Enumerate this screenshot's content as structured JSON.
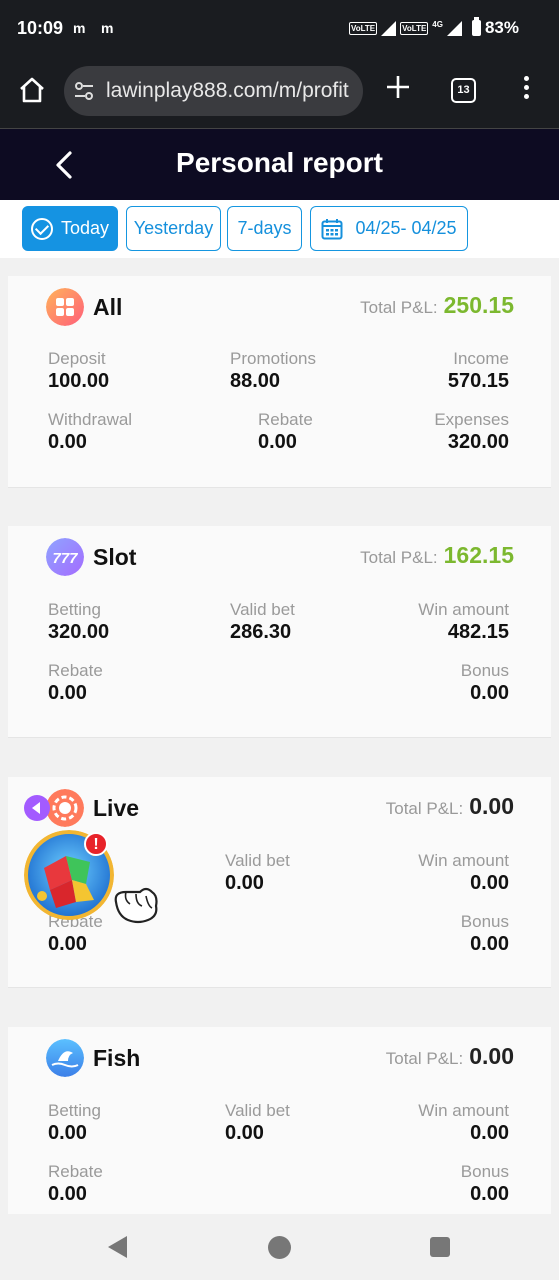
{
  "status_bar": {
    "time": "10:09",
    "notifications": [
      "m",
      "m"
    ],
    "network_labels": [
      "VoLTE",
      "VoLTE"
    ],
    "network_type": "4G",
    "battery": "83%"
  },
  "browser": {
    "url": "lawinplay888.com/m/profit",
    "tab_count": "13",
    "icons": [
      "home-icon",
      "tune-icon",
      "plus-icon",
      "tabs-icon",
      "more-vert-icon"
    ]
  },
  "header": {
    "title": "Personal report"
  },
  "filters": {
    "today": "Today",
    "yesterday": "Yesterday",
    "seven_days": "7-days",
    "date_range": "04/25- 04/25",
    "active": "Today"
  },
  "colors": {
    "accent": "#1593e2",
    "profit_green": "#7cb82f",
    "header_bg": "#0d0b22"
  },
  "cards": {
    "all": {
      "name": "All",
      "pl_label": "Total P&L:",
      "pl_value": "250.15",
      "deposit_label": "Deposit",
      "deposit": "100.00",
      "promotions_label": "Promotions",
      "promotions": "88.00",
      "income_label": "Income",
      "income": "570.15",
      "withdrawal_label": "Withdrawal",
      "withdrawal": "0.00",
      "rebate_label": "Rebate",
      "rebate": "0.00",
      "expenses_label": "Expenses",
      "expenses": "320.00"
    },
    "slot": {
      "name": "Slot",
      "pl_label": "Total P&L:",
      "pl_value": "162.15",
      "betting_label": "Betting",
      "betting": "320.00",
      "valid_bet_label": "Valid bet",
      "valid_bet": "286.30",
      "win_amount_label": "Win amount",
      "win_amount": "482.15",
      "rebate_label": "Rebate",
      "rebate": "0.00",
      "bonus_label": "Bonus",
      "bonus": "0.00"
    },
    "live": {
      "name": "Live",
      "pl_label": "Total P&L:",
      "pl_value": "0.00",
      "valid_bet_label": "Valid bet",
      "valid_bet": "0.00",
      "win_amount_label": "Win amount",
      "win_amount": "0.00",
      "rebate_label": "Rebate",
      "rebate": "0.00",
      "bonus_label": "Bonus",
      "bonus": "0.00"
    },
    "fish": {
      "name": "Fish",
      "pl_label": "Total P&L:",
      "pl_value": "0.00",
      "betting_label": "Betting",
      "betting": "0.00",
      "valid_bet_label": "Valid bet",
      "valid_bet": "0.00",
      "win_amount_label": "Win amount",
      "win_amount": "0.00",
      "rebate_label": "Rebate",
      "rebate": "0.00",
      "bonus_label": "Bonus",
      "bonus": "0.00"
    }
  },
  "floating": {
    "badge": "!"
  }
}
